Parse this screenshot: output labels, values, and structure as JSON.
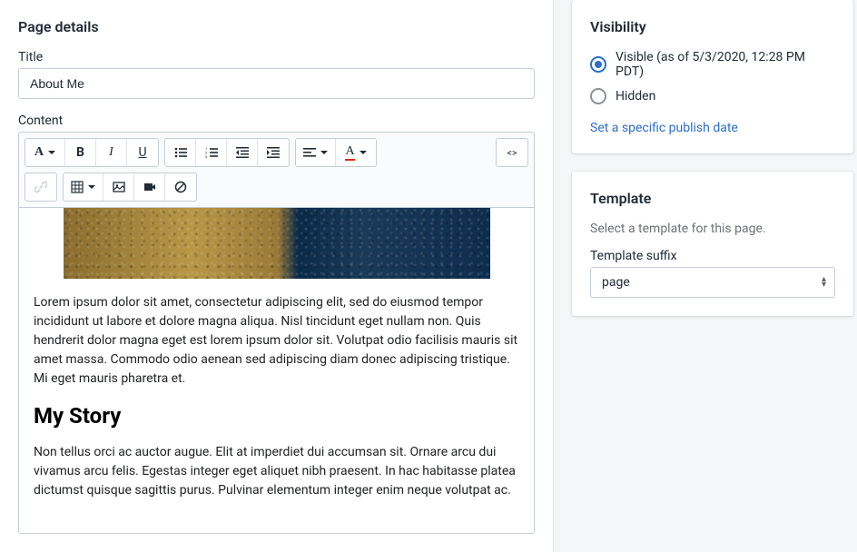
{
  "pageDetails": {
    "heading": "Page details",
    "titleLabel": "Title",
    "titleValue": "About Me",
    "contentLabel": "Content",
    "body": {
      "para1": "Lorem ipsum dolor sit amet, consectetur adipiscing elit, sed do eiusmod tempor incididunt ut labore et dolore magna aliqua. Nisl tincidunt eget nullam non. Quis hendrerit dolor magna eget est lorem ipsum dolor sit. Volutpat odio facilisis mauris sit amet massa. Commodo odio aenean sed adipiscing diam donec adipiscing tristique. Mi eget mauris pharetra et.",
      "heading1": "My Story",
      "para2": "Non tellus orci ac auctor augue. Elit at imperdiet dui accumsan sit. Ornare arcu dui vivamus arcu felis. Egestas integer eget aliquet nibh praesent. In hac habitasse platea dictumst quisque sagittis purus. Pulvinar elementum integer enim neque volutpat ac."
    }
  },
  "visibility": {
    "heading": "Visibility",
    "visibleLabel": "Visible (as of 5/3/2020, 12:28 PM PDT)",
    "hiddenLabel": "Hidden",
    "publishLink": "Set a specific publish date"
  },
  "template": {
    "heading": "Template",
    "helpText": "Select a template for this page.",
    "suffixLabel": "Template suffix",
    "suffixValue": "page"
  }
}
